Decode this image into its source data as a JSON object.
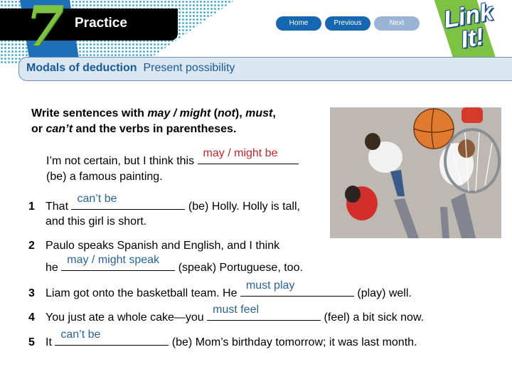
{
  "header": {
    "unit_number": "7",
    "section_label": "Practice",
    "nav": {
      "home": "Home",
      "previous": "Previous",
      "next": "Next"
    },
    "logo_text_line1": "Link",
    "logo_text_line2": "It!"
  },
  "title": {
    "topic": "Modals of deduction",
    "subtopic": "Present possibility"
  },
  "instructions": {
    "part1": "Write sentences with ",
    "em1": "may / might",
    "part2": " (",
    "em2": "not",
    "part3": "), ",
    "em3": "must",
    "part4": ",",
    "part5": "or ",
    "em4": "can’t",
    "part6": " and the verbs in parentheses."
  },
  "example": {
    "before": "I’m not certain, but I think this ",
    "answer": "may / might be",
    "after_line2": "(be) a famous painting."
  },
  "items": [
    {
      "number": "1",
      "before": "That ",
      "answer": "can’t be",
      "after": " (be) Holly. Holly is tall,",
      "line2": "and this girl is short."
    },
    {
      "number": "2",
      "before": "Paulo speaks Spanish and English, and I think",
      "line2_before": "he ",
      "answer": "may / might speak",
      "after": " (speak) Portuguese, too."
    },
    {
      "number": "3",
      "before": "Liam got onto the basketball team. He ",
      "answer": "must play",
      "after": " (play) well."
    },
    {
      "number": "4",
      "before": "You just ate a whole cake—you ",
      "answer": "must feel",
      "after": " (feel) a bit sick now."
    },
    {
      "number": "5",
      "before": "It ",
      "answer": "can’t be",
      "after": " (be) Mom’s birthday tomorrow; it was last month."
    }
  ],
  "colors": {
    "example_answer": "#c0272d",
    "answer": "#2a6496",
    "nav_active": "#1567b0",
    "nav_disabled": "#9ab4d6",
    "title_text": "#1a5a94"
  },
  "photo": {
    "description": "Teens playing basketball viewed from above, ball near hoop"
  }
}
